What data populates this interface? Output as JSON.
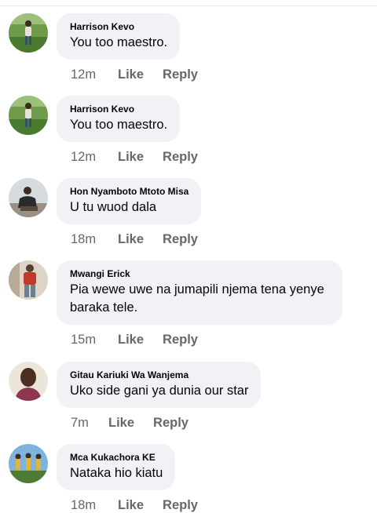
{
  "comments": [
    {
      "author": "Harrison Kevo",
      "text": "You too maestro.",
      "time": "12m",
      "like_label": "Like",
      "reply_label": "Reply",
      "avatar": "harrison-avatar",
      "avatar_colors": [
        "#5a8a3a",
        "#3f6b2a",
        "#d9c3a5"
      ]
    },
    {
      "author": "Harrison Kevo",
      "text": "You too maestro.",
      "time": "12m",
      "like_label": "Like",
      "reply_label": "Reply",
      "avatar": "harrison-avatar",
      "avatar_colors": [
        "#5a8a3a",
        "#3f6b2a",
        "#d9c3a5"
      ]
    },
    {
      "author": "Hon Nyamboto Mtoto Misa",
      "text": "U tu wuod dala",
      "time": "18m",
      "like_label": "Like",
      "reply_label": "Reply",
      "avatar": "nyamboto-avatar",
      "avatar_colors": [
        "#cfd6de",
        "#2b2b2b",
        "#8a7a6a"
      ]
    },
    {
      "author": "Mwangi Erick",
      "text": "Pia wewe uwe na jumapili njema tena yenye baraka tele.",
      "time": "15m",
      "like_label": "Like",
      "reply_label": "Reply",
      "avatar": "mwangi-avatar",
      "avatar_colors": [
        "#d8cfc4",
        "#c0392b",
        "#7a5236"
      ]
    },
    {
      "author": "Gitau Kariuki Wa Wanjema",
      "text": "Uko side gani ya dunia our star",
      "time": "7m",
      "like_label": "Like",
      "reply_label": "Reply",
      "avatar": "gitau-avatar",
      "avatar_colors": [
        "#e9e2d6",
        "#5a3a2a",
        "#9b3b5a"
      ]
    },
    {
      "author": "Mca Kukachora KE",
      "text": "Nataka hio kiatu",
      "time": "18m",
      "like_label": "Like",
      "reply_label": "Reply",
      "avatar": "kukachora-avatar",
      "avatar_colors": [
        "#6fa8d6",
        "#e0b23a",
        "#3a5f2a"
      ]
    }
  ],
  "colors": {
    "bubble": "#f0f2f5",
    "meta_text": "#65676b",
    "author_text": "#050505"
  }
}
